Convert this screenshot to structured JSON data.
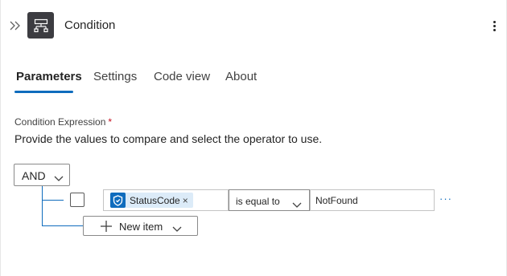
{
  "header": {
    "title": "Condition",
    "collapse_icon": "double-chevron-right-icon",
    "action_icon": "condition-icon",
    "more_icon": "more-vertical-icon"
  },
  "tabs": [
    {
      "label": "Parameters",
      "active": true
    },
    {
      "label": "Settings",
      "active": false
    },
    {
      "label": "Code view",
      "active": false
    },
    {
      "label": "About",
      "active": false
    }
  ],
  "condition": {
    "label": "Condition Expression",
    "required_marker": "*",
    "description": "Provide the values to compare and select the operator to use.",
    "group_operator": "AND",
    "rows": [
      {
        "left_token": {
          "label": "StatusCode",
          "remove": "×",
          "icon": "shield-icon"
        },
        "operator": "is equal to",
        "right_value": "NotFound",
        "more": "···"
      }
    ],
    "new_item_label": "New item"
  },
  "colors": {
    "accent": "#0f6cbd",
    "token_bg": "#dcebf8",
    "icon_bg": "#3c3c41",
    "required": "#c50f1f"
  }
}
